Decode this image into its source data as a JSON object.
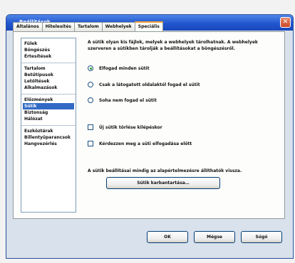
{
  "window": {
    "title": "Beállítások",
    "close_glyph": "✕"
  },
  "tabs": [
    {
      "label": "Általános",
      "active": false
    },
    {
      "label": "Hitelesítés",
      "active": false
    },
    {
      "label": "Tartalom",
      "active": false
    },
    {
      "label": "Webhelyek",
      "active": false
    },
    {
      "label": "Speciális",
      "active": true
    }
  ],
  "sidebar": {
    "groups": [
      {
        "items": [
          "Fülek",
          "Böngészés",
          "Értesítések"
        ]
      },
      {
        "items": [
          "Tartalom",
          "Betűtípusok",
          "Letöltések",
          "Alkalmazások"
        ]
      },
      {
        "items": [
          "Előzmények",
          "Sütik",
          "Biztonság",
          "Hálózat"
        ]
      },
      {
        "items": [
          "Eszköztárak",
          "Billentyűparancsok",
          "Hangvezérlés"
        ]
      }
    ],
    "selected": "Sütik"
  },
  "content": {
    "description": "A sütik olyan kis fájlok, melyek a webhelyek tárolhatnak. A webhelyek szerveren a sütikben tárolják a beállításokat a böngészésről.",
    "radio_options": [
      {
        "label": "Elfogad minden sütit",
        "checked": true
      },
      {
        "label": "Csak a látogatott oldalaktól fogad el sütit",
        "checked": false
      },
      {
        "label": "Soha nem fogad el sütit",
        "checked": false
      }
    ],
    "checkbox_options": [
      {
        "label": "Új sütik törlése kilépéskor",
        "checked": false
      },
      {
        "label": "Kérdezzen meg a süti elfogadása előtt",
        "checked": false
      }
    ],
    "note": "A sütik beállításai mindig az alapértelmezésre állíthatók vissza.",
    "reset_button": "Sütik karbantartása…"
  },
  "buttons": {
    "ok": "OK",
    "cancel": "Mégse",
    "help": "Súgó"
  },
  "colors": {
    "titlebar": "#2156cf",
    "active_tab_accent": "#f5a33b",
    "selection": "#316ac5"
  }
}
